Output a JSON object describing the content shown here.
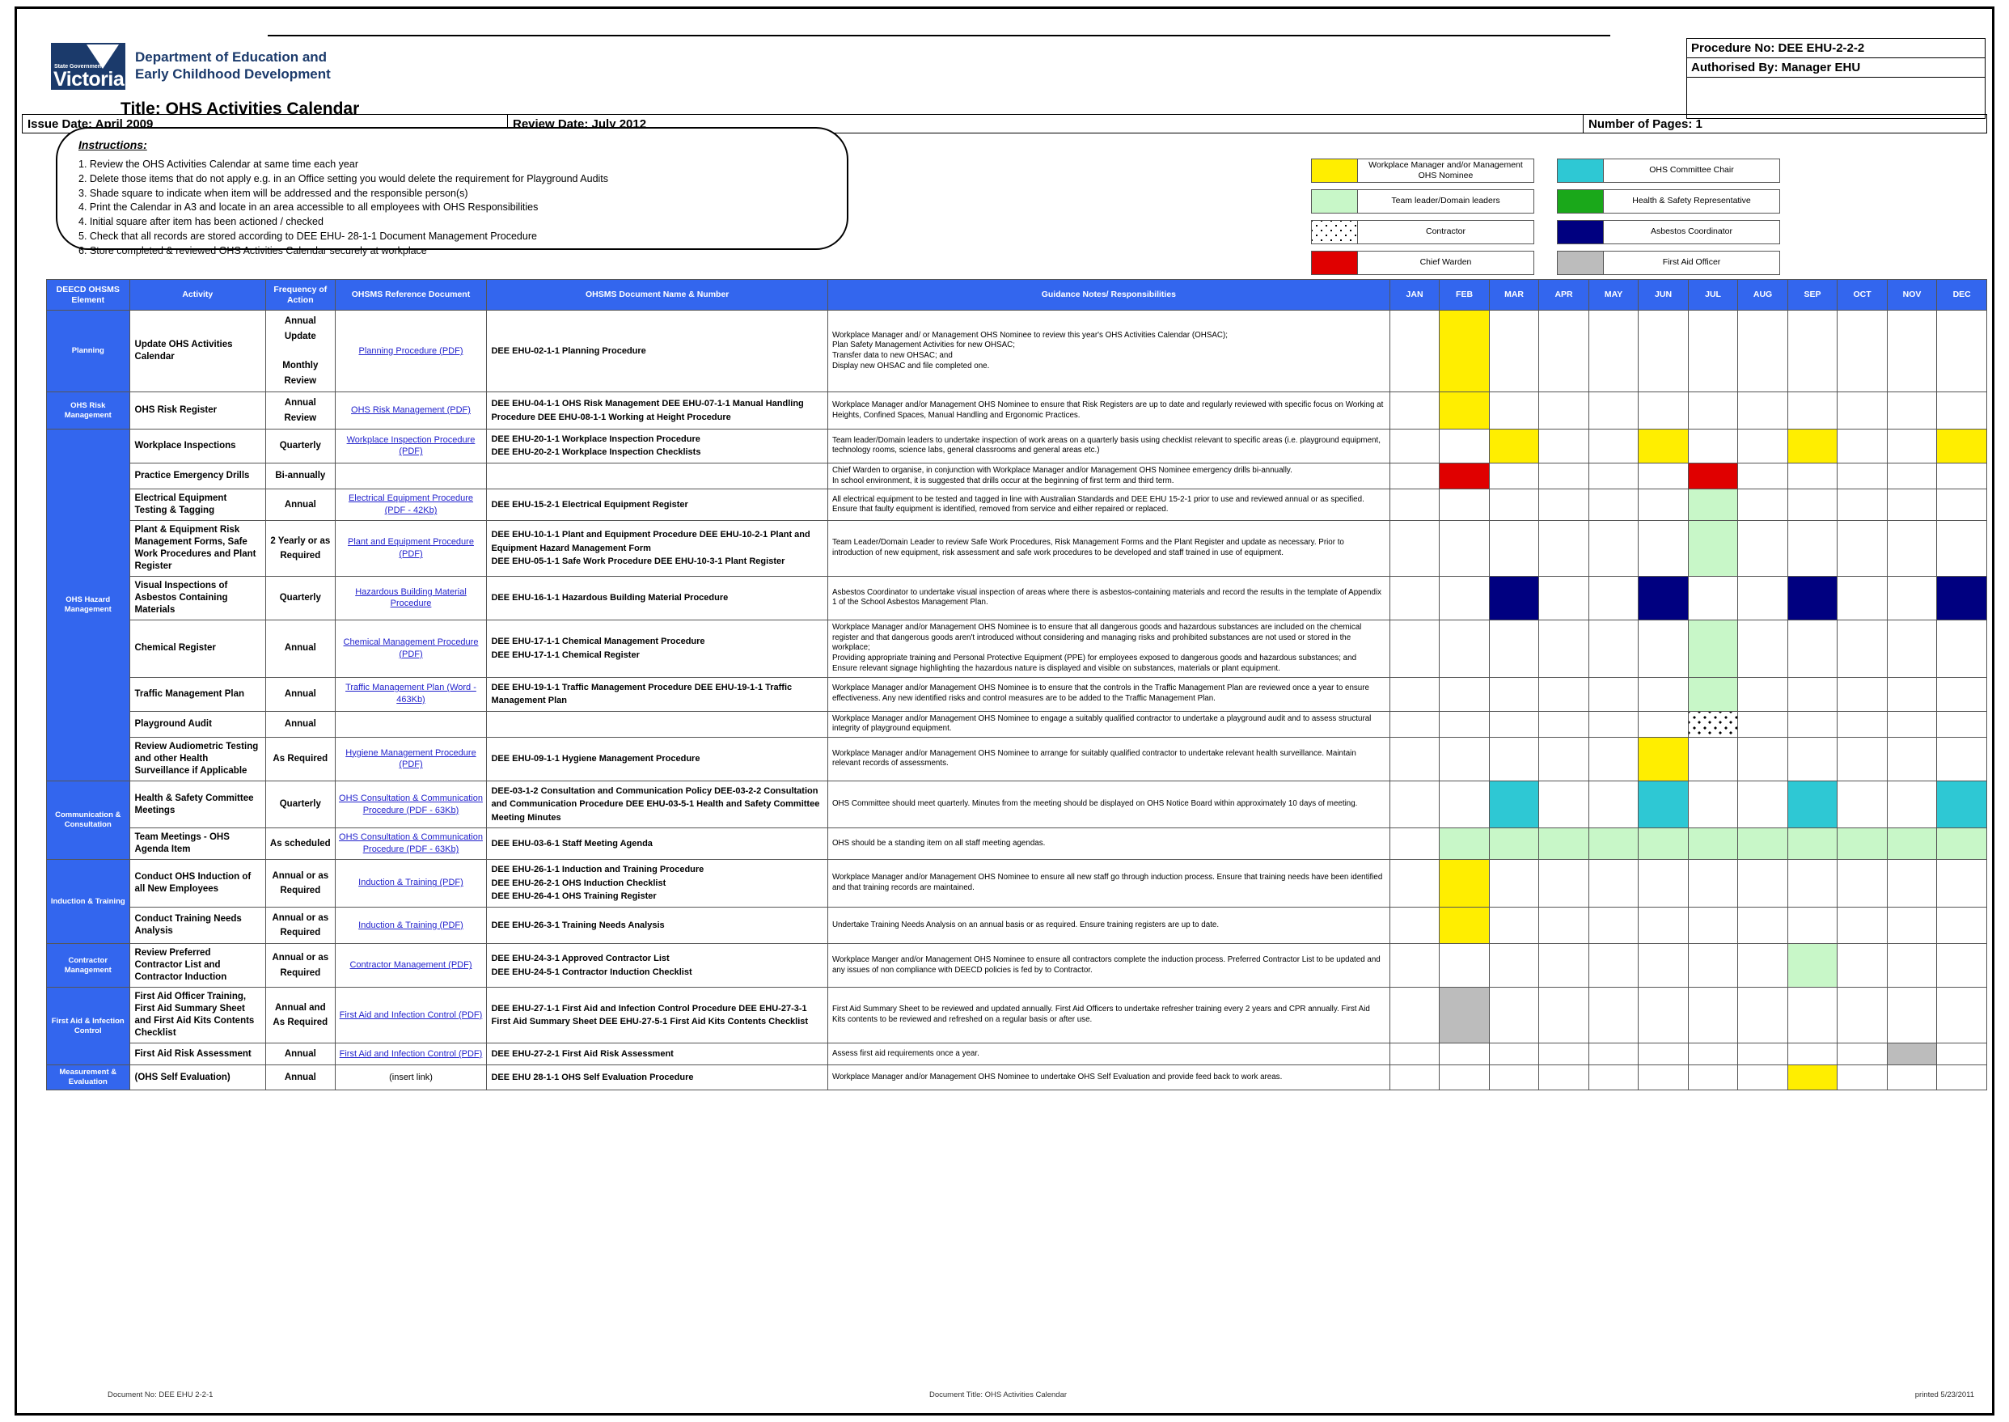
{
  "header": {
    "org_state": "State Government",
    "org_name": "Victoria",
    "department_line1": "Department of Education and",
    "department_line2": "Early Childhood Development",
    "title": "Title: OHS Activities Calendar",
    "procedure_no": "Procedure No: DEE EHU-2-2-2",
    "authorised_by": "Authorised By: Manager EHU",
    "number_of_pages": "Number of Pages: 1",
    "issue_date": "Issue Date:      April 2009",
    "review_date": "Review Date: July 2012",
    "blank_cell": ""
  },
  "instructions": {
    "heading": "Instructions:",
    "items": [
      "1. Review the OHS Activities Calendar at same time each year",
      "2. Delete those items that do not apply e.g. in an Office setting you would delete the requirement for Playground Audits",
      "3. Shade square to indicate when item will be addressed and the responsible person(s)",
      "4. Print the Calendar in A3 and locate in an area accessible to all employees with OHS Responsibilities",
      "4. Initial square after item has been actioned / checked",
      "5. Check that all records are stored according to DEE EHU- 28-1-1 Document Management Procedure",
      "6. Store completed & reviewed OHS Activities Calendar securely at workplace"
    ]
  },
  "legend": [
    {
      "label": "Workplace Manager and/or Management OHS Nominee",
      "color": "#ffee00",
      "key": "yellow"
    },
    {
      "label": "OHS Committee Chair",
      "color": "#2ec8d4",
      "key": "cyan"
    },
    {
      "label": "Team leader/Domain leaders",
      "color": "#c8f7c8",
      "key": "green"
    },
    {
      "label": "Health & Safety Representative",
      "color": "#1aa81a",
      "key": "darkgreen"
    },
    {
      "label": "Contractor",
      "color": "#ffffff",
      "key": "dots"
    },
    {
      "label": "Asbestos Coordinator",
      "color": "#000080",
      "key": "navy"
    },
    {
      "label": "Chief Warden",
      "color": "#e00000",
      "key": "red"
    },
    {
      "label": "First Aid Officer",
      "color": "#bcbcbc",
      "key": "grey"
    }
  ],
  "table": {
    "columns": [
      "DEECD OHSMS Element",
      "Activity",
      "Frequency of Action",
      "OHSMS Reference Document",
      "OHSMS Document Name & Number",
      "Guidance Notes/ Responsibilities"
    ],
    "months": [
      "JAN",
      "FEB",
      "MAR",
      "APR",
      "MAY",
      "JUN",
      "JUL",
      "AUG",
      "SEP",
      "OCT",
      "NOV",
      "DEC"
    ],
    "rows": [
      {
        "element": "Planning",
        "element_rowspan": 1,
        "activity": "Update OHS Activities Calendar",
        "frequency": "Annual Update\n\nMonthly Review",
        "reference": "Planning Procedure (PDF)",
        "reference_link": true,
        "document": "DEE EHU-02-1-1 Planning Procedure",
        "guidance": "Workplace Manager and/ or Management OHS Nominee to review this year's OHS Activities Calendar (OHSAC);\nPlan Safety Management Activities for new OHSAC;\nTransfer data to new OHSAC; and\nDisplay new OHSAC and file completed one.",
        "months": [
          "",
          "yellow",
          "",
          "",
          "",
          "",
          "",
          "",
          "",
          "",
          "",
          ""
        ]
      },
      {
        "element": "OHS Risk Management",
        "element_rowspan": 1,
        "activity": "OHS Risk Register",
        "frequency": "Annual Review",
        "reference": "OHS Risk Management (PDF)",
        "reference_link": true,
        "document": "DEE EHU-04-1-1 OHS Risk Management                          DEE EHU-07-1-1 Manual Handling Procedure                 DEE EHU-08-1-1 Working at Height Procedure",
        "guidance": "Workplace Manager and/or Management OHS Nominee to ensure that Risk Registers are up to date and regularly reviewed with specific focus on  Working at Heights, Confined Spaces, Manual Handling and Ergonomic Practices.",
        "months": [
          "",
          "yellow",
          "",
          "",
          "",
          "",
          "",
          "",
          "",
          "",
          "",
          ""
        ]
      },
      {
        "element": "OHS Hazard Management",
        "element_rowspan": 9,
        "activity": "Workplace Inspections",
        "frequency": "Quarterly",
        "reference": "Workplace Inspection Procedure (PDF)",
        "reference_link": true,
        "document": "DEE EHU-20-1-1 Workplace Inspection Procedure\nDEE EHU-20-2-1 Workplace Inspection Checklists",
        "guidance": "Team leader/Domain leaders to undertake inspection of work areas on a quarterly basis using checklist relevant to specific areas (i.e. playground equipment, technology rooms, science labs, general classrooms and general areas etc.)",
        "months": [
          "",
          "",
          "yellow",
          "",
          "",
          "yellow",
          "",
          "",
          "yellow",
          "",
          "",
          "yellow"
        ]
      },
      {
        "element": "",
        "activity": "Practice Emergency Drills",
        "frequency": "Bi-annually",
        "reference": "",
        "reference_link": false,
        "document": "",
        "guidance": "Chief Warden to organise, in conjunction with Workplace Manager and/or Management OHS Nominee emergency drills bi-annually.\nIn school environment, it is suggested that drills occur at the beginning of first term and third term.",
        "months": [
          "",
          "red",
          "",
          "",
          "",
          "",
          "red",
          "",
          "",
          "",
          "",
          ""
        ]
      },
      {
        "element": "",
        "activity": "Electrical Equipment Testing & Tagging",
        "frequency": "Annual",
        "reference": "Electrical  Equipment  Procedure (PDF - 42Kb)",
        "reference_link": true,
        "document": "DEE EHU-15-2-1 Electrical Equipment Register",
        "guidance": "All electrical equipment to be tested and tagged in line with Australian Standards and DEE EHU 15-2-1 prior to use and reviewed annual or as specified.\nEnsure that faulty equipment is identified, removed from service and either repaired or replaced.",
        "months": [
          "",
          "",
          "",
          "",
          "",
          "",
          "green",
          "",
          "",
          "",
          "",
          ""
        ]
      },
      {
        "element": "",
        "activity": "Plant & Equipment Risk Management Forms, Safe Work Procedures and Plant Register",
        "frequency": "2 Yearly or as Required",
        "reference": "Plant and Equipment Procedure (PDF)",
        "reference_link": true,
        "document": "DEE EHU-10-1-1 Plant and Equipment Procedure                        DEE EHU-10-2-1 Plant and Equipment Hazard Management Form\nDEE EHU-05-1-1 Safe Work Procedure                DEE EHU-10-3-1 Plant Register",
        "guidance": "Team Leader/Domain Leader to review Safe Work Procedures, Risk Management Forms and the Plant Register and update as necessary.  Prior to introduction of new equipment, risk assessment and safe work procedures to be developed and staff trained in use of equipment.",
        "months": [
          "",
          "",
          "",
          "",
          "",
          "",
          "green",
          "",
          "",
          "",
          "",
          ""
        ]
      },
      {
        "element": "",
        "activity": "Visual Inspections of Asbestos Containing Materials",
        "frequency": "Quarterly",
        "reference": "Hazardous Building Material Procedure",
        "reference_link": true,
        "document": "DEE EHU-16-1-1 Hazardous Building Material Procedure",
        "guidance": "Asbestos Coordinator to undertake visual inspection of areas where there is asbestos-containing materials and record the results in the template of Appendix 1 of the School Asbestos Management Plan.",
        "months": [
          "",
          "",
          "navy",
          "",
          "",
          "navy",
          "",
          "",
          "navy",
          "",
          "",
          "navy"
        ]
      },
      {
        "element": "",
        "activity": "Chemical Register",
        "frequency": "Annual",
        "reference": "Chemical Management Procedure (PDF)",
        "reference_link": true,
        "document": "DEE EHU-17-1-1 Chemical Management Procedure\nDEE EHU-17-1-1 Chemical Register",
        "guidance": "Workplace Manager and/or Management OHS Nominee is to  ensure that all dangerous goods and hazardous substances are included on the chemical register and that dangerous goods aren't introduced without considering and managing risks and prohibited substances are not used or stored in the workplace;\nProviding appropriate training and Personal Protective Equipment (PPE) for employees exposed to dangerous goods and hazardous substances; and\nEnsure relevant signage highlighting the hazardous nature is displayed and visible on substances, materials or plant equipment.",
        "months": [
          "",
          "",
          "",
          "",
          "",
          "",
          "green",
          "",
          "",
          "",
          "",
          ""
        ]
      },
      {
        "element": "",
        "activity": "Traffic Management Plan",
        "frequency": "Annual",
        "reference": "Traffic  Management  Plan  (Word - 463Kb)",
        "reference_link": true,
        "document": "DEE EHU-19-1-1 Traffic Management Procedure                         DEE EHU-19-1-1 Traffic Management Plan",
        "guidance": "Workplace Manager and/or Management OHS Nominee is to ensure that the controls in the Traffic Management Plan are reviewed once a year to ensure effectiveness. Any new identified risks and control measures are to be added to the Traffic Management Plan.",
        "months": [
          "",
          "",
          "",
          "",
          "",
          "",
          "green",
          "",
          "",
          "",
          "",
          ""
        ]
      },
      {
        "element": "",
        "activity": "Playground Audit",
        "frequency": "Annual",
        "reference": "",
        "reference_link": false,
        "document": "",
        "guidance": "Workplace Manager and/or Management OHS Nominee to engage a suitably qualified contractor to undertake a playground audit and to assess structural integrity of playground equipment.",
        "months": [
          "",
          "",
          "",
          "",
          "",
          "",
          "dots",
          "",
          "",
          "",
          "",
          ""
        ]
      },
      {
        "element": "",
        "activity": "Review Audiometric Testing and other Health Surveillance if Applicable",
        "frequency": "As Required",
        "reference": "Hygiene Management Procedure (PDF)",
        "reference_link": true,
        "document": "DEE EHU-09-1-1 Hygiene Management Procedure",
        "guidance": "Workplace Manager and/or Management OHS Nominee to arrange for suitably qualified contractor to undertake relevant health surveillance. Maintain relevant records of assessments.",
        "months": [
          "",
          "",
          "",
          "",
          "",
          "yellow",
          "",
          "",
          "",
          "",
          "",
          ""
        ]
      },
      {
        "element": "Communication & Consultation",
        "element_rowspan": 2,
        "activity": "Health & Safety Committee Meetings",
        "frequency": "Quarterly",
        "reference": "OHS  Consultation  & Communication Procedure (PDF - 63Kb)",
        "reference_link": true,
        "document": "DEE-03-1-2 Consultation and Communication Policy                             DEE-03-2-2 Consultation and Communication Procedure                        DEE EHU-03-5-1 Health and Safety Committee Meeting Minutes",
        "guidance": "OHS Committee should meet quarterly.  Minutes from the meeting should be displayed on OHS Notice Board within approximately 10 days of meeting.",
        "months": [
          "",
          "",
          "cyan",
          "",
          "",
          "cyan",
          "",
          "",
          "cyan",
          "",
          "",
          "cyan"
        ]
      },
      {
        "element": "",
        "activity": "Team Meetings - OHS Agenda Item",
        "frequency": "As scheduled",
        "reference": "OHS  Consultation  & Communication Procedure (PDF - 63Kb)",
        "reference_link": true,
        "document": "DEE EHU-03-6-1 Staff Meeting Agenda",
        "guidance": "OHS should be a standing item on all staff meeting agendas.",
        "months": [
          "",
          "green",
          "green",
          "green",
          "green",
          "green",
          "green",
          "green",
          "green",
          "green",
          "green",
          "green"
        ]
      },
      {
        "element": "Induction & Training",
        "element_rowspan": 2,
        "activity": "Conduct OHS Induction of all New Employees",
        "frequency": "Annual or as Required",
        "reference": "Induction & Training (PDF)",
        "reference_link": true,
        "document": "DEE EHU-26-1-1 Induction and Training Procedure\nDEE EHU-26-2-1 OHS Induction Checklist\nDEE EHU-26-4-1 OHS Training Register",
        "guidance": "Workplace Manager and/or Management OHS Nominee to ensure all new staff go through induction process. Ensure that training needs have been identified and that training records are maintained.",
        "months": [
          "",
          "yellow",
          "",
          "",
          "",
          "",
          "",
          "",
          "",
          "",
          "",
          ""
        ]
      },
      {
        "element": "",
        "activity": "Conduct Training Needs Analysis",
        "frequency": "Annual or as Required",
        "reference": "Induction & Training (PDF)",
        "reference_link": true,
        "document": "DEE EHU-26-3-1 Training Needs Analysis",
        "guidance": "Undertake Training Needs Analysis on an annual basis or as required. Ensure training registers are up to date.",
        "months": [
          "",
          "yellow",
          "",
          "",
          "",
          "",
          "",
          "",
          "",
          "",
          "",
          ""
        ]
      },
      {
        "element": "Contractor Management",
        "element_rowspan": 1,
        "activity": "Review Preferred Contractor List and Contractor Induction",
        "frequency": "Annual or as Required",
        "reference": "Contractor Management (PDF)",
        "reference_link": true,
        "document": "DEE EHU-24-3-1 Approved Contractor List\nDEE EHU-24-5-1 Contractor Induction Checklist",
        "guidance": "Workplace Manger and/or Management OHS Nominee to ensure all contractors complete the induction process. Preferred Contractor List to be updated and any issues of non compliance with DEECD policies is fed by to Contractor.",
        "months": [
          "",
          "",
          "",
          "",
          "",
          "",
          "",
          "",
          "green",
          "",
          "",
          ""
        ]
      },
      {
        "element": "First Aid & Infection Control",
        "element_rowspan": 2,
        "activity": "First Aid Officer Training, First Aid Summary Sheet and First Aid Kits Contents Checklist",
        "frequency": "Annual and  As Required",
        "reference": "First Aid and Infection Control (PDF)",
        "reference_link": true,
        "document": "DEE EHU-27-1-1  First Aid and Infection Control Procedure                                    DEE EHU-27-3-1 First Aid Summary Sheet            DEE EHU-27-5-1 First Aid Kits Contents Checklist",
        "guidance": "First Aid Summary Sheet to be reviewed and updated annually. First Aid Officers to undertake refresher training every 2 years and CPR annually. First Aid Kits contents to be reviewed and refreshed on a regular basis or after use.",
        "months": [
          "",
          "grey",
          "",
          "",
          "",
          "",
          "",
          "",
          "",
          "",
          "",
          ""
        ]
      },
      {
        "element": "",
        "activity": "First Aid Risk Assessment",
        "frequency": "Annual",
        "reference": "First Aid and Infection Control (PDF)",
        "reference_link": true,
        "document": "DEE EHU-27-2-1 First Aid Risk Assessment",
        "guidance": "Assess first aid requirements once a year.",
        "months": [
          "",
          "",
          "",
          "",
          "",
          "",
          "",
          "",
          "",
          "",
          "grey",
          ""
        ]
      },
      {
        "element": "Measurement & Evaluation",
        "element_rowspan": 1,
        "activity": "(OHS Self Evaluation)",
        "frequency": "Annual",
        "reference": "(insert link)",
        "reference_link": false,
        "document": "DEE EHU 28-1-1 OHS Self Evaluation Procedure",
        "guidance": "Workplace Manager and/or Management OHS Nominee to undertake OHS Self Evaluation and provide feed back to work areas.",
        "months": [
          "",
          "",
          "",
          "",
          "",
          "",
          "",
          "",
          "yellow",
          "",
          "",
          ""
        ]
      }
    ]
  },
  "footer": {
    "document_no": "Document No:  DEE EHU 2-2-1",
    "document_title": "Document Title: OHS Activities Calendar",
    "printed": "printed 5/23/2011"
  }
}
